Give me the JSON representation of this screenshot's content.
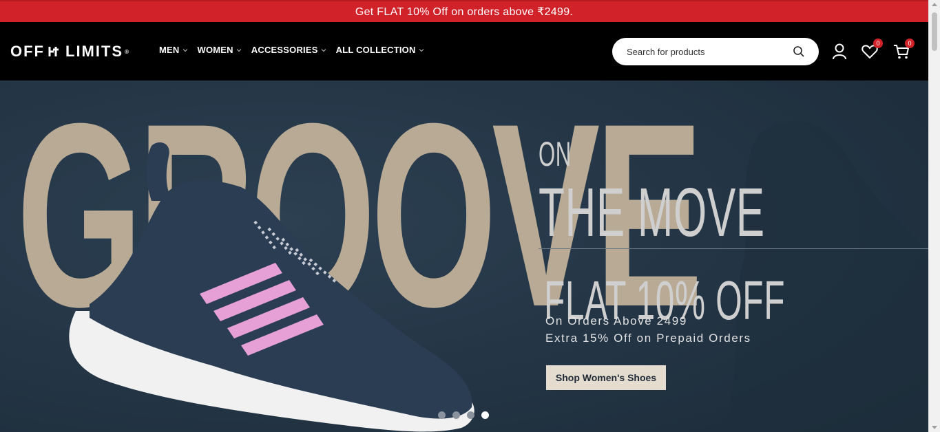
{
  "promo": {
    "text": "Get FLAT 10% Off on orders above ₹2499."
  },
  "header": {
    "logo_left": "OFF",
    "logo_right": "LIMITS",
    "logo_mark": "®",
    "nav": [
      {
        "label": "MEN"
      },
      {
        "label": "WOMEN"
      },
      {
        "label": "ACCESSORIES"
      },
      {
        "label": "ALL COLLECTION"
      }
    ],
    "search": {
      "placeholder": "Search for products",
      "value": ""
    },
    "wishlist_count": "0",
    "cart_count": "0"
  },
  "hero": {
    "bg_word": "GROOVE",
    "line1": "ON",
    "line2": "THE MOVE",
    "line3": "FLAT 10% OFF",
    "sub1": "On Orders Above  2499",
    "sub2": "Extra 15% Off on Prepaid Orders",
    "cta": "Shop Women's Shoes",
    "slides": 4,
    "active_slide": 4
  },
  "colors": {
    "promo_bg": "#d1222a",
    "header_bg": "#000000",
    "hero_bg": "#253646",
    "accent_stripes": "#e6a0d6"
  }
}
